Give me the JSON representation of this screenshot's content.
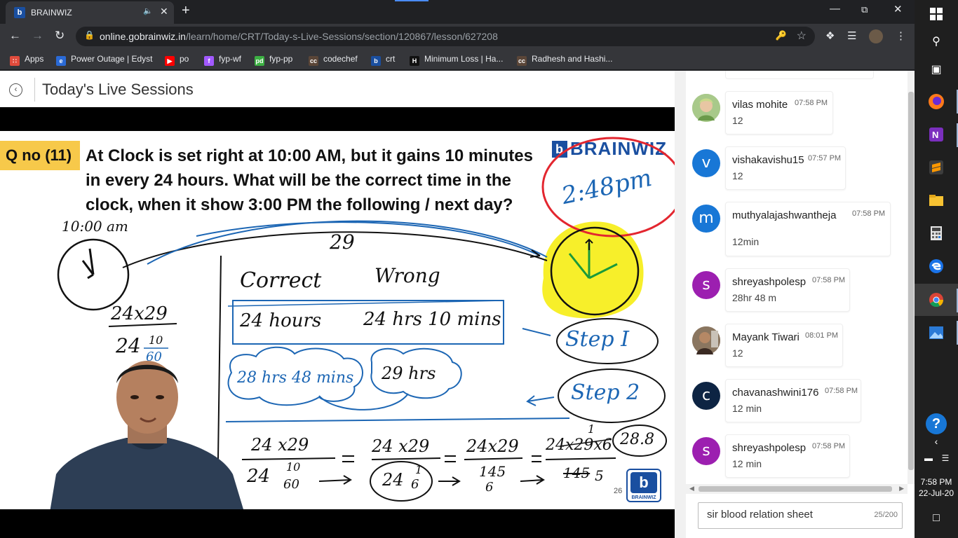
{
  "browser": {
    "tab_title": "BRAINWIZ",
    "tab_favicon": "b",
    "url_host": "online.gobrainwiz.in",
    "url_path": "/learn/home/CRT/Today-s-Live-Sessions/section/120867/lesson/627208",
    "bookmarks": [
      {
        "label": "Apps",
        "icon": "apps-grid-icon",
        "color": "#e04b3c"
      },
      {
        "label": "Power Outage | Edyst",
        "icon": "edyst-icon",
        "color": "#2a6ad6"
      },
      {
        "label": "po",
        "icon": "youtube-icon",
        "color": "#ff0000"
      },
      {
        "label": "fyp-wf",
        "icon": "figma-icon",
        "color": "#a259ff"
      },
      {
        "label": "fyp-pp",
        "icon": "pd-icon",
        "color": "#3cb043"
      },
      {
        "label": "codechef",
        "icon": "codechef-icon",
        "color": "#5b4638"
      },
      {
        "label": "crt",
        "icon": "brainwiz-icon",
        "color": "#1a4fa0"
      },
      {
        "label": "Minimum Loss | Ha...",
        "icon": "hackerrank-icon",
        "color": "#111111"
      },
      {
        "label": "Radhesh and Hashi...",
        "icon": "codechef-icon",
        "color": "#5b4638"
      }
    ]
  },
  "page": {
    "title": "Today's Live Sessions"
  },
  "slide": {
    "qno": "Q no (11)",
    "question": "At Clock is set right at 10:00 AM, but it gains 10 minutes in every 24 hours. What will be the correct time in the clock, when it show 3:00 PM the following / next day?",
    "brand": "BRAINWIZ",
    "slide_number": "26",
    "logo_text": "BRAINWIZ",
    "handwriting": {
      "answer": "2:48pm",
      "start_time": "10:00 am",
      "hours": "29",
      "correct": "Correct",
      "wrong": "Wrong",
      "correct_val": "24 hours",
      "wrong_val": "24 hrs 10 mins",
      "step1": "Step I",
      "step2": "Step 2",
      "cloud1": "28 hrs 48 mins",
      "cloud2": "29 hrs",
      "left_calc_top": "24x29",
      "left_calc_mid": "24",
      "left_frac_num": "10",
      "left_frac_den": "60",
      "result": "28.8",
      "one": "1",
      "eq1_num": "24 x29",
      "eq1_den_a": "24",
      "eq1_den_num": "10",
      "eq1_den_den": "60",
      "eq2_num": "24 x29",
      "eq2_den_a": "24",
      "eq2_den_num": "1",
      "eq2_den_den": "6",
      "eq3_num": "24x29",
      "eq3_den": "145",
      "eq3_den2": "6",
      "eq4_num": "24x29x6",
      "eq4_den": "145",
      "eq4_den2": "5"
    }
  },
  "chat": {
    "messages": [
      {
        "name": "vilas mohite",
        "time": "07:58 PM",
        "text": "12",
        "avatar_letter": "",
        "avatar_color": "#8fb86a",
        "has_photo": true
      },
      {
        "name": "vishakavishu15",
        "time": "07:57 PM",
        "text": "12",
        "avatar_letter": "v",
        "avatar_color": "#1877d6"
      },
      {
        "name": "muthyalajashwantheja",
        "time": "07:58 PM",
        "text": "12min",
        "avatar_letter": "m",
        "avatar_color": "#1877d6"
      },
      {
        "name": "shreyashpolesp",
        "time": "07:58 PM",
        "text": "28hr 48 m",
        "avatar_letter": "s",
        "avatar_color": "#9c1fb0"
      },
      {
        "name": "Mayank Tiwari",
        "time": "08:01 PM",
        "text": "12",
        "avatar_letter": "",
        "avatar_color": "#7a5c44",
        "has_photo": true
      },
      {
        "name": "chavanashwini176",
        "time": "07:58 PM",
        "text": "12 min",
        "avatar_letter": "c",
        "avatar_color": "#0d2443"
      },
      {
        "name": "shreyashpolesp",
        "time": "07:58 PM",
        "text": "12 min",
        "avatar_letter": "s",
        "avatar_color": "#9c1fb0"
      }
    ],
    "input_value": "sir blood relation sheet",
    "char_count": "25/200"
  },
  "taskbar": {
    "time": "7:58 PM",
    "date": "22-Jul-20",
    "icons": [
      "windows-start-icon",
      "search-icon",
      "task-view-icon",
      "firefox-icon",
      "onenote-icon",
      "sublime-icon",
      "file-explorer-icon",
      "calculator-icon",
      "edge-icon",
      "chrome-icon",
      "photos-icon",
      "help-icon",
      "chevron-up-icon",
      "battery-icon",
      "wifi-icon",
      "notifications-icon"
    ]
  }
}
